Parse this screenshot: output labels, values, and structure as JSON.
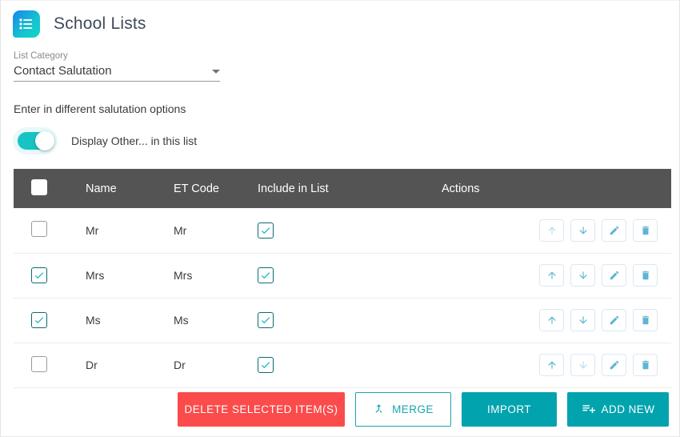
{
  "header": {
    "title": "School Lists",
    "icon": "list-icon"
  },
  "category_field": {
    "label": "List Category",
    "value": "Contact Salutation",
    "caret_icon": "chevron-down-icon"
  },
  "helper_text": "Enter in different salutation options",
  "toggle": {
    "label": "Display Other... in this list",
    "state": "on"
  },
  "table": {
    "columns": {
      "select": "",
      "name": "Name",
      "et_code": "ET Code",
      "include": "Include in List",
      "actions": "Actions"
    },
    "header_checkbox_checked": false,
    "rows": [
      {
        "selected": false,
        "name": "Mr",
        "et_code": "Mr",
        "include": true,
        "up_enabled": false,
        "down_enabled": true
      },
      {
        "selected": true,
        "name": "Mrs",
        "et_code": "Mrs",
        "include": true,
        "up_enabled": true,
        "down_enabled": true
      },
      {
        "selected": true,
        "name": "Ms",
        "et_code": "Ms",
        "include": true,
        "up_enabled": true,
        "down_enabled": true
      },
      {
        "selected": false,
        "name": "Dr",
        "et_code": "Dr",
        "include": true,
        "up_enabled": true,
        "down_enabled": false
      }
    ],
    "row_action_icons": [
      "arrow-up-icon",
      "arrow-down-icon",
      "pencil-edit-icon",
      "trash-delete-icon"
    ]
  },
  "footer": {
    "delete_label": "DELETE SELECTED ITEM(S)",
    "merge_label": "MERGE",
    "merge_icon": "call-merge-icon",
    "import_label": "IMPORT",
    "add_new_label": "ADD NEW",
    "add_new_icon": "playlist-add-icon"
  },
  "colors": {
    "accent_teal": "#00a3ae",
    "danger_red": "#fb4b4b",
    "table_header_gray": "#545454",
    "toggle_on": "#17c4c4",
    "checkbox_border": "#0c6b72",
    "action_icon": "#5fb4d4",
    "action_icon_disabled": "#b9dcec"
  }
}
